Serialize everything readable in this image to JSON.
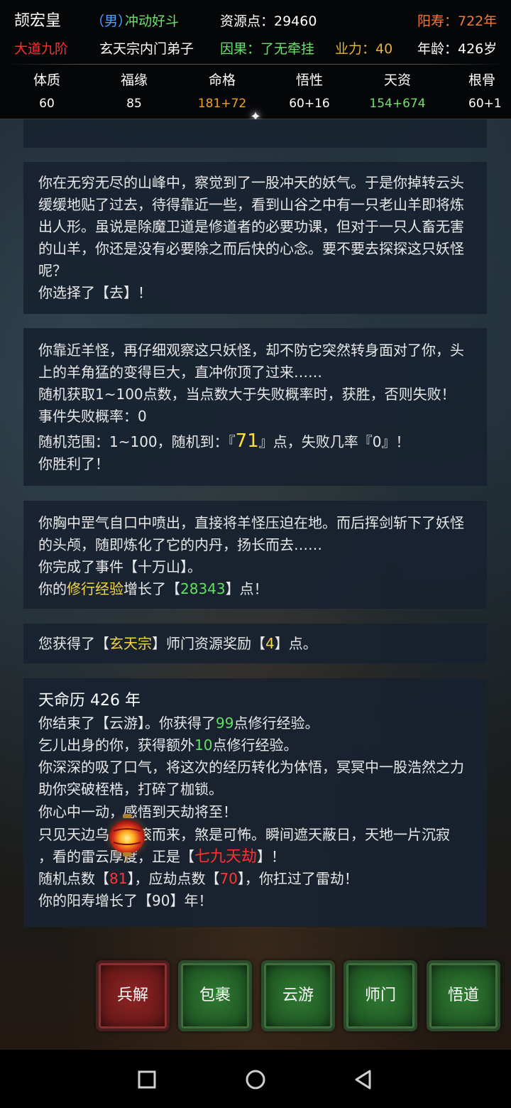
{
  "header": {
    "name": "颉宏皇",
    "gender": "（男）",
    "trait": "冲动好斗",
    "resource": "资源点：29460",
    "lifespan": "阳寿：722年",
    "realm": "大道九阶",
    "sect": "玄天宗内门弟子",
    "karma": "因果：了无牵挂",
    "merit": "业力：40",
    "age": "年龄：426岁"
  },
  "stats": [
    {
      "label": "体质",
      "value": "60",
      "color": "#ffffff"
    },
    {
      "label": "福缘",
      "value": "85",
      "color": "#ffffff"
    },
    {
      "label": "命格",
      "value": "181+72",
      "color": "#f0a020"
    },
    {
      "label": "悟性",
      "value": "60+16",
      "color": "#ffffff"
    },
    {
      "label": "天资",
      "value": "154+674",
      "color": "#6ee06e"
    },
    {
      "label": "根骨",
      "value": "60+1",
      "color": "#ffffff"
    }
  ],
  "log": {
    "e1_text": "你在无穷无尽的山峰中，察觉到了一股冲天的妖气。于是你掉转云头缓缓地贴了过去，待得靠近一些，看到山谷之中有一只老山羊即将炼出人形。虽说是除魔卫道是修道者的必要功课，但对于一只人畜无害的山羊，你还是没有必要除之而后快的心念。要不要去探探这只妖怪呢？",
    "e1_choice": "你选择了【去】！",
    "e2_text": "你靠近羊怪，再仔细观察这只妖怪，却不防它突然转身面对了你，头上的羊角猛的变得巨大，直冲你顶了过来……",
    "e2_rule": "随机获取1~100点数，当点数大于失败概率时，获胜，否则失败！",
    "e2_fail": "事件失败概率：0",
    "e2_range_a": "随机范围：1~100，随机到：『",
    "e2_roll": "71",
    "e2_range_b": "』点，失败几率『0』！",
    "e2_win": "你胜利了！",
    "e3_text": "你胸中罡气自口中喷出，直接将羊怪压迫在地。而后挥剑斩下了妖怪的头颅，随即炼化了它的内丹，扬长而去……",
    "e3_done": "你完成了事件【十万山】。",
    "e3_exp_a": "你的",
    "e3_exp_b": "修行经验",
    "e3_exp_c": "增长了【",
    "e3_exp_d": "28343",
    "e3_exp_e": "】点！",
    "e4_a": "您获得了【",
    "e4_b": "玄天宗",
    "e4_c": "】师门资源奖励【",
    "e4_d": "4",
    "e4_e": "】点。",
    "e5_year": "天命历 426 年",
    "e5_l1a": "你结束了【云游】。你获得了",
    "e5_l1b": "99",
    "e5_l1c": "点修行经验。",
    "e5_l2a": "乞儿出身的你，获得额外",
    "e5_l2b": "10",
    "e5_l2c": "点修行经验。",
    "e5_l3": "你深深的吸了口气，将这次的经历转化为体悟，冥冥中一股浩然之力助你突破桎梏，打碎了枷锁。",
    "e5_l4": "你心中一动，感悟到天劫将至！",
    "e5_l5": "只见天边乌云滚滚而来，煞是可怖。瞬间遮天蔽日，天地一片沉寂",
    "e5_l6a": "，看的雷云厚度，正是【",
    "e5_l6b": "七九天劫",
    "e5_l6c": "】！",
    "e5_l7a": "随机点数【",
    "e5_l7b": "81",
    "e5_l7c": "】，应劫点数【",
    "e5_l7d": "70",
    "e5_l7e": "】，你扛过了雷劫！",
    "e5_l8": "你的阳寿增长了【90】年！"
  },
  "buttons": {
    "b1": "兵解",
    "b2": "包裹",
    "b3": "云游",
    "b4": "师门",
    "b5": "悟道"
  },
  "colors": {
    "green": "#5fe25f",
    "red": "#ff3636",
    "yellow": "#f3d64a",
    "pink": "#e07aeb"
  }
}
